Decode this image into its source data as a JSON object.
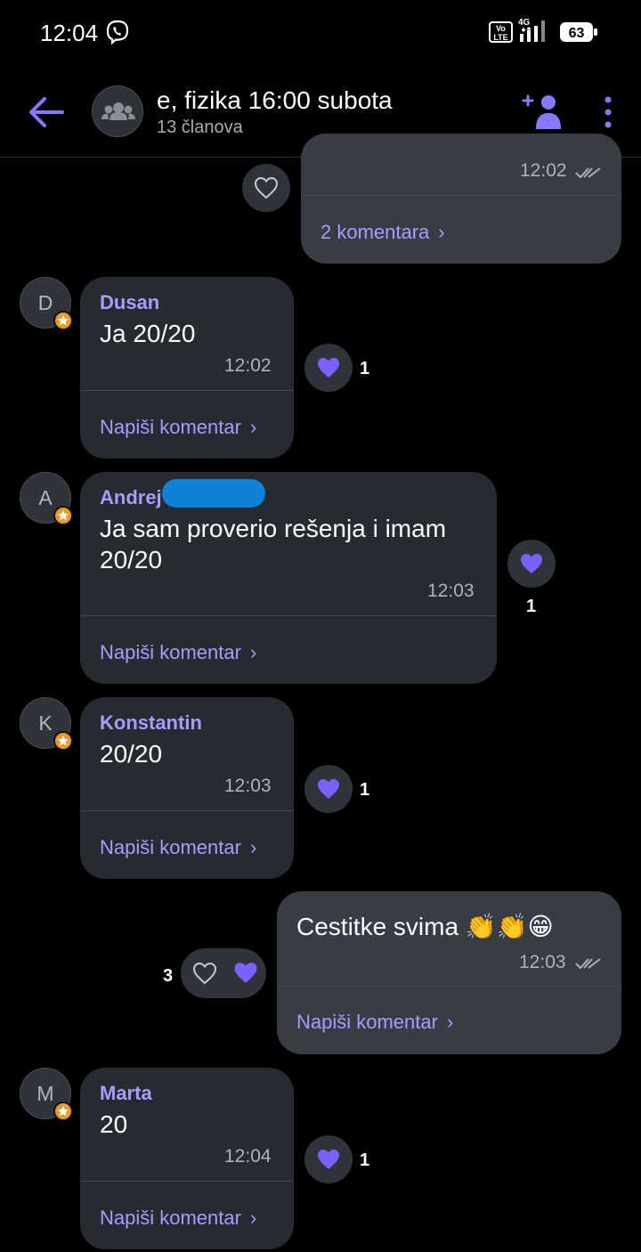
{
  "status_bar": {
    "time": "12:04",
    "volte": "Vo LTE",
    "network": "4G",
    "battery": "63"
  },
  "header": {
    "title": "e, fizika 16:00 subota",
    "subtitle": "13 članova"
  },
  "top_partial": {
    "time": "12:02",
    "comments": "2 komentara"
  },
  "messages": [
    {
      "avatar": "D",
      "sender": "Dusan",
      "text": "Ja 20/20",
      "time": "12:02",
      "comment": "Napiši komentar",
      "likes": "1"
    },
    {
      "avatar": "A",
      "sender": "Andrej",
      "text_line1": "Ja sam proverio rešenja i imam",
      "text_line2": "20/20",
      "time": "12:03",
      "comment": "Napiši komentar",
      "likes": "1"
    },
    {
      "avatar": "K",
      "sender": "Konstantin",
      "text": "20/20",
      "time": "12:03",
      "comment": "Napiši komentar",
      "likes": "1"
    },
    {
      "avatar": "M",
      "sender": "Marta",
      "text": "20",
      "time": "12:04",
      "comment": "Napiši komentar",
      "likes": "1"
    }
  ],
  "outgoing": {
    "text": "Cestitke svima 👏👏😁",
    "time": "12:03",
    "comment": "Napiši komentar",
    "likes": "3"
  },
  "colors": {
    "accent": "#a89cff",
    "heart": "#7b61ff",
    "incoming_bubble": "#262a31",
    "outgoing_bubble": "#383c45"
  }
}
